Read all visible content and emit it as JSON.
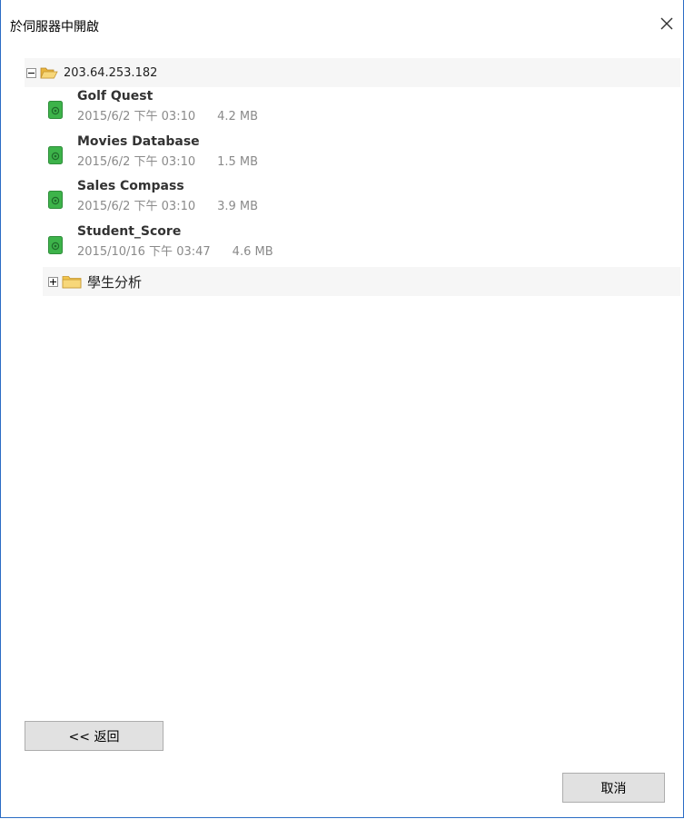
{
  "dialog": {
    "title": "於伺服器中開啟"
  },
  "tree": {
    "root": {
      "label": "203.64.253.182",
      "expanded": true,
      "icon": "folder-open-icon"
    },
    "files": [
      {
        "name": "Golf Quest",
        "date": "2015/6/2 下午 03:10",
        "size": "4.2 MB",
        "icon": "workbook-icon"
      },
      {
        "name": "Movies Database",
        "date": "2015/6/2 下午 03:10",
        "size": "1.5 MB",
        "icon": "workbook-icon"
      },
      {
        "name": "Sales Compass",
        "date": "2015/6/2 下午 03:10",
        "size": "3.9 MB",
        "icon": "workbook-icon"
      },
      {
        "name": "Student_Score",
        "date": "2015/10/16 下午 03:47",
        "size": "4.6 MB",
        "icon": "workbook-icon"
      }
    ],
    "subfolder": {
      "label": "學生分析",
      "expanded": false,
      "icon": "folder-closed-icon"
    }
  },
  "buttons": {
    "back": "<< 返回",
    "cancel": "取消"
  },
  "colors": {
    "border": "#2b6cc4",
    "folder": "#f2c54c",
    "file_icon": "#3db34a",
    "meta_text": "#8a8a8a",
    "button_bg": "#e1e1e1"
  }
}
